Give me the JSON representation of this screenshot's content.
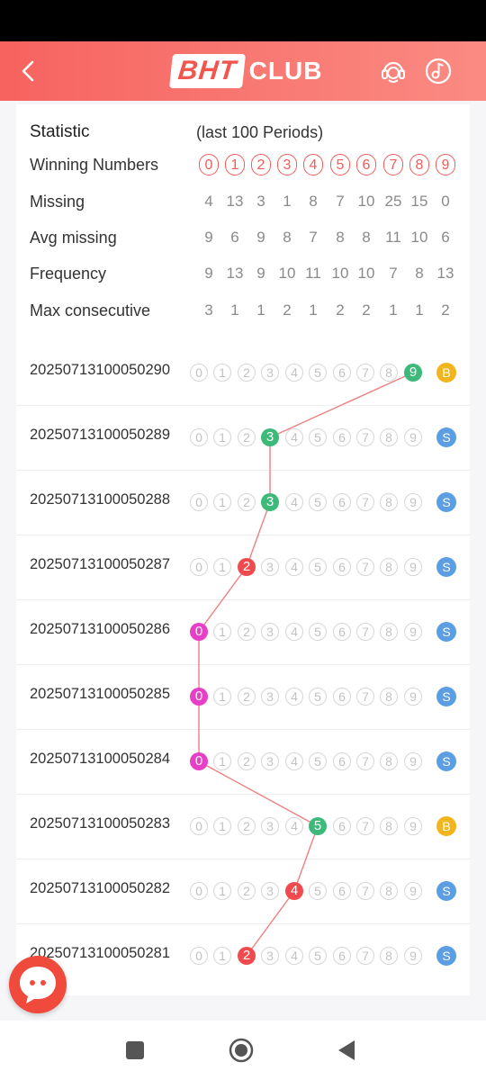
{
  "header": {
    "logo_box_text": "BHT",
    "logo_club_text": "CLUB"
  },
  "stats": {
    "title": "Statistic",
    "period_label": "(last 100 Periods)",
    "winning_label": "Winning Numbers",
    "numbers": [
      "0",
      "1",
      "2",
      "3",
      "4",
      "5",
      "6",
      "7",
      "8",
      "9"
    ],
    "rows": [
      {
        "label": "Missing",
        "values": [
          "4",
          "13",
          "3",
          "1",
          "8",
          "7",
          "10",
          "25",
          "15",
          "0"
        ]
      },
      {
        "label": "Avg missing",
        "values": [
          "9",
          "6",
          "9",
          "8",
          "7",
          "8",
          "8",
          "11",
          "10",
          "6"
        ]
      },
      {
        "label": "Frequency",
        "values": [
          "9",
          "13",
          "9",
          "10",
          "11",
          "10",
          "10",
          "7",
          "8",
          "13"
        ]
      },
      {
        "label": "Max consecutive",
        "values": [
          "3",
          "1",
          "1",
          "2",
          "1",
          "2",
          "2",
          "1",
          "1",
          "2"
        ]
      }
    ]
  },
  "draws": [
    {
      "period": "20250713100050290",
      "number": 9,
      "size": "B"
    },
    {
      "period": "20250713100050289",
      "number": 3,
      "size": "S"
    },
    {
      "period": "20250713100050288",
      "number": 3,
      "size": "S"
    },
    {
      "period": "20250713100050287",
      "number": 2,
      "size": "S"
    },
    {
      "period": "20250713100050286",
      "number": 0,
      "size": "S"
    },
    {
      "period": "20250713100050285",
      "number": 0,
      "size": "S"
    },
    {
      "period": "20250713100050284",
      "number": 0,
      "size": "S"
    },
    {
      "period": "20250713100050283",
      "number": 5,
      "size": "B"
    },
    {
      "period": "20250713100050282",
      "number": 4,
      "size": "S"
    },
    {
      "period": "20250713100050281",
      "number": 2,
      "size": "S"
    }
  ],
  "colors": {
    "header_start": "#f7635f",
    "header_end": "#fa8b83",
    "red": "#f04a4e",
    "green": "#3db97a",
    "violet": "#e73fc5",
    "big": "#f2b51c",
    "small": "#5b9ee3",
    "line": "#f08080"
  },
  "icons": {
    "back": "back-arrow-icon",
    "service": "customer-service-icon",
    "music": "music-note-icon",
    "chat": "chat-bubble-icon",
    "recent": "square-icon",
    "home": "circle-icon",
    "back_nav": "triangle-back-icon"
  }
}
